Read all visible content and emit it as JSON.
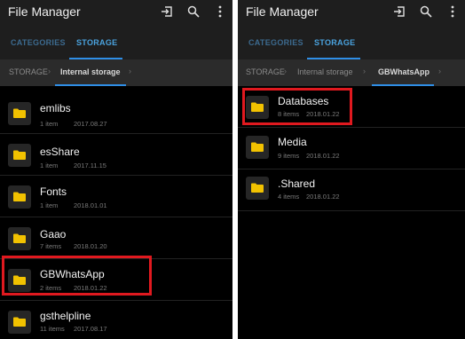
{
  "left": {
    "title": "File Manager",
    "tabs": {
      "categories": "CATEGORIES",
      "storage": "STORAGE"
    },
    "breadcrumb": {
      "root": "STORAGE",
      "current": "Internal storage",
      "sep": "›"
    },
    "items": [
      {
        "name": "emlibs",
        "count": "1 item",
        "date": "2017.08.27"
      },
      {
        "name": "esShare",
        "count": "1 item",
        "date": "2017.11.15"
      },
      {
        "name": "Fonts",
        "count": "1 item",
        "date": "2018.01.01"
      },
      {
        "name": "Gaao",
        "count": "7 items",
        "date": "2018.01.20"
      },
      {
        "name": "GBWhatsApp",
        "count": "2 items",
        "date": "2018.01.22"
      },
      {
        "name": "gsthelpline",
        "count": "11 items",
        "date": "2017.08.17"
      }
    ]
  },
  "right": {
    "title": "File Manager",
    "tabs": {
      "categories": "CATEGORIES",
      "storage": "STORAGE"
    },
    "breadcrumb": {
      "root": "STORAGE",
      "mid": "Internal storage",
      "current": "GBWhatsApp",
      "sep": "›"
    },
    "items": [
      {
        "name": "Databases",
        "count": "8 items",
        "date": "2018.01.22"
      },
      {
        "name": "Media",
        "count": "9 items",
        "date": "2018.01.22"
      },
      {
        "name": ".Shared",
        "count": "4 items",
        "date": "2018.01.22"
      }
    ]
  },
  "icons": {
    "export": "export-icon",
    "search": "search-icon",
    "more": "more-vertical-icon",
    "folder": "folder-icon"
  },
  "colors": {
    "accent": "#2f8ee6",
    "folder": "#f2c200",
    "highlight": "#e0191f",
    "background": "#000000"
  }
}
